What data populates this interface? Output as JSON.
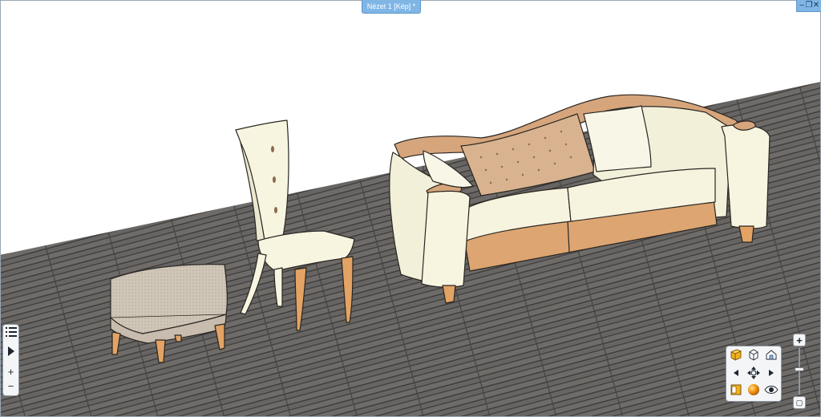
{
  "view_tab": {
    "label": "Nézet 1 [Kép] *"
  },
  "window_controls": {
    "minimize": "‒",
    "restore": "❐",
    "close": "✕"
  },
  "left_toolbar": {
    "list_icon": "list-icon",
    "play_icon": "play-icon",
    "add_label": "+",
    "remove_label": "−"
  },
  "nav_pad": {
    "icons": [
      "perspective-cube-icon",
      "iso-cube-icon",
      "house-view-icon",
      "arrow-left-icon",
      "orbit-icon",
      "arrow-right-icon",
      "floor-plan-icon",
      "render-sphere-icon",
      "eye-icon"
    ]
  },
  "zoom": {
    "in_label": "+",
    "out_label": "▢"
  },
  "colors": {
    "accent": "#7fb6e6",
    "floor": "#6c6a68",
    "upholstery": "#f5f2dd",
    "wood": "#e2a364",
    "trim": "#d6a57c",
    "ottoman": "#cfc6b8"
  }
}
